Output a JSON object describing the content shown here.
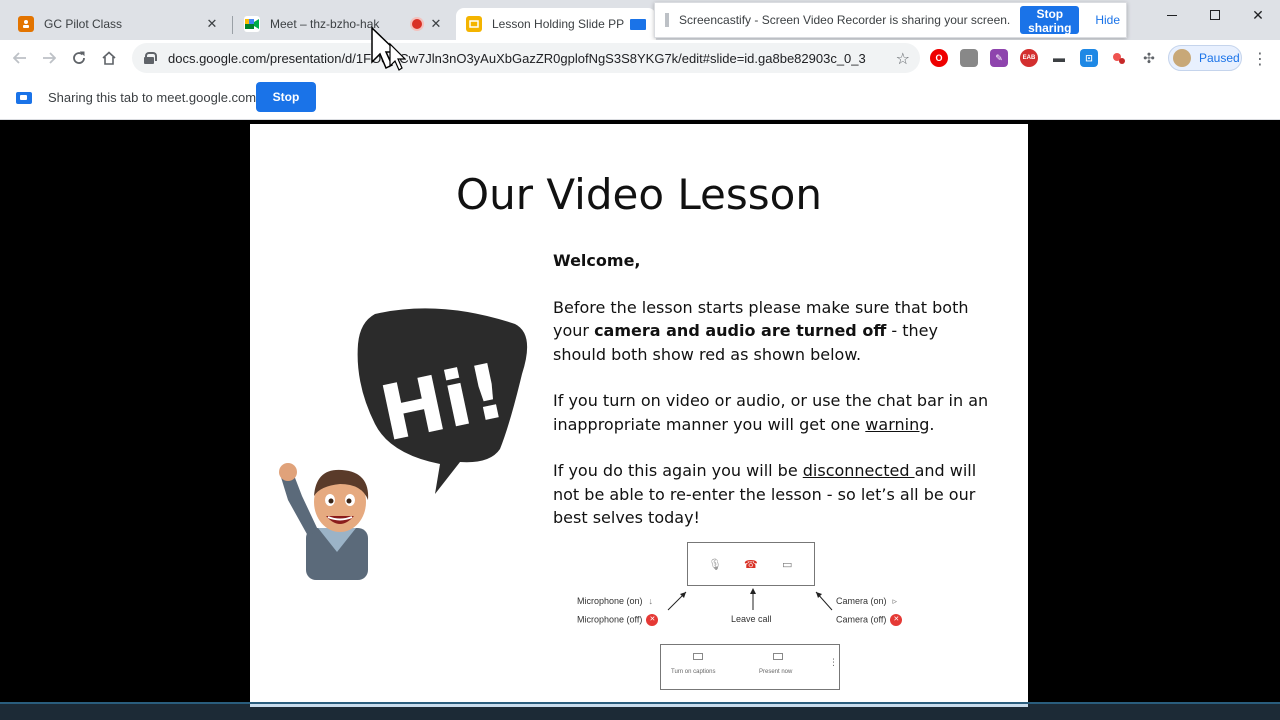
{
  "tabs": [
    {
      "title": "GC Pilot Class",
      "favicon_color": "#e37400"
    },
    {
      "title": "Meet – thz-bzho-hak",
      "favicon_color": "#00832d"
    },
    {
      "title": "Lesson Holding Slide PP - Go",
      "favicon_color": "#f4b400"
    }
  ],
  "notification": {
    "message": "Screencastify - Screen Video Recorder is sharing your screen.",
    "stop_label": "Stop sharing",
    "hide_label": "Hide"
  },
  "toolbar": {
    "url": "docs.google.com/presentation/d/1FO8...Cw7Jln3nO3yAuXbGazZR0gplofNgS3S8YKG7k/edit#slide=id.ga8be82903c_0_3",
    "profile_label": "Paused"
  },
  "sharebar": {
    "text": "Sharing this tab to meet.google.com",
    "stop_label": "Stop"
  },
  "slide": {
    "title": "Our Video Lesson",
    "welcome": "Welcome,",
    "p1_a": "Before the lesson starts please make sure that both your ",
    "p1_b": "camera and audio are turned off",
    "p1_c": " - they should both show red as shown below.",
    "p2_a": "If you turn on video or audio, or use the chat bar in an inappropriate manner you will get one ",
    "p2_b": "warning",
    "p2_c": ".",
    "p3_a": "If you do this again you will be ",
    "p3_b": "disconnected ",
    "p3_c": "and will not be able to re-enter the lesson - so let’s all be our best selves today!",
    "bubble_text": "Hi!"
  },
  "diagram": {
    "mic_on": "Microphone (on)",
    "mic_off": "Microphone (off)",
    "leave_call": "Leave call",
    "cam_on": "Camera (on)",
    "cam_off": "Camera (off)",
    "captions": "Turn on captions",
    "present": "Present now"
  }
}
